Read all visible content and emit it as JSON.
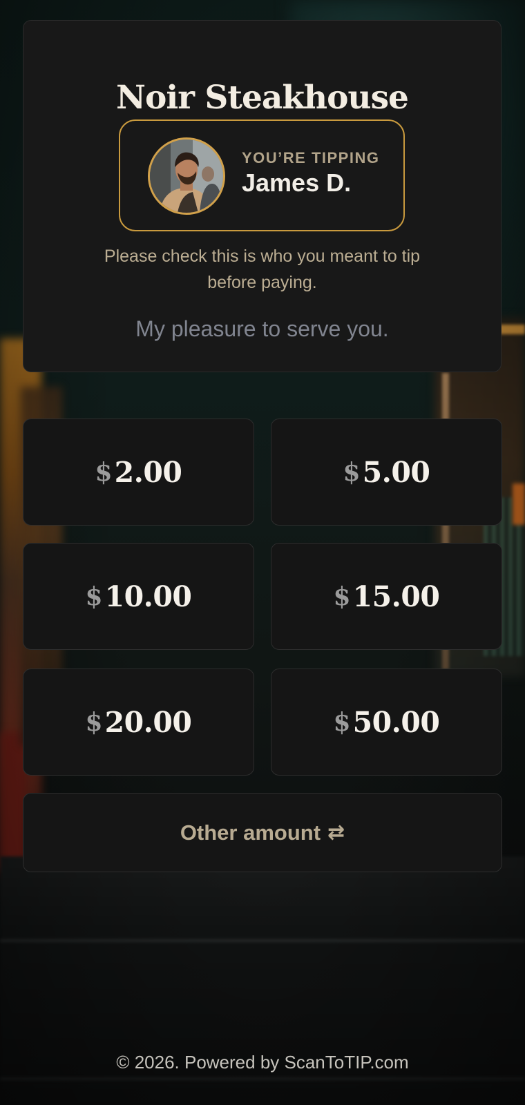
{
  "restaurant": {
    "name": "Noir Steakhouse"
  },
  "staff": {
    "kicker": "YOU’RE TIPPING",
    "name": "James D.",
    "avatar_icon": "staff-photo"
  },
  "notice": "Please check this is who you meant to tip before paying.",
  "message": "My pleasure to serve you.",
  "amounts": [
    {
      "currency": "$",
      "value": "2.00"
    },
    {
      "currency": "$",
      "value": "5.00"
    },
    {
      "currency": "$",
      "value": "10.00"
    },
    {
      "currency": "$",
      "value": "15.00"
    },
    {
      "currency": "$",
      "value": "20.00"
    },
    {
      "currency": "$",
      "value": "50.00"
    }
  ],
  "other": {
    "label": "Other amount",
    "icon_glyph": "⇄",
    "icon": "swap-arrows-icon"
  },
  "footer": "© 2026. Powered by ScanToTIP.com",
  "colors": {
    "accent": "#c99a3e",
    "card_bg": "#181818",
    "button_bg": "#151515",
    "muted_text": "#bcae93"
  }
}
